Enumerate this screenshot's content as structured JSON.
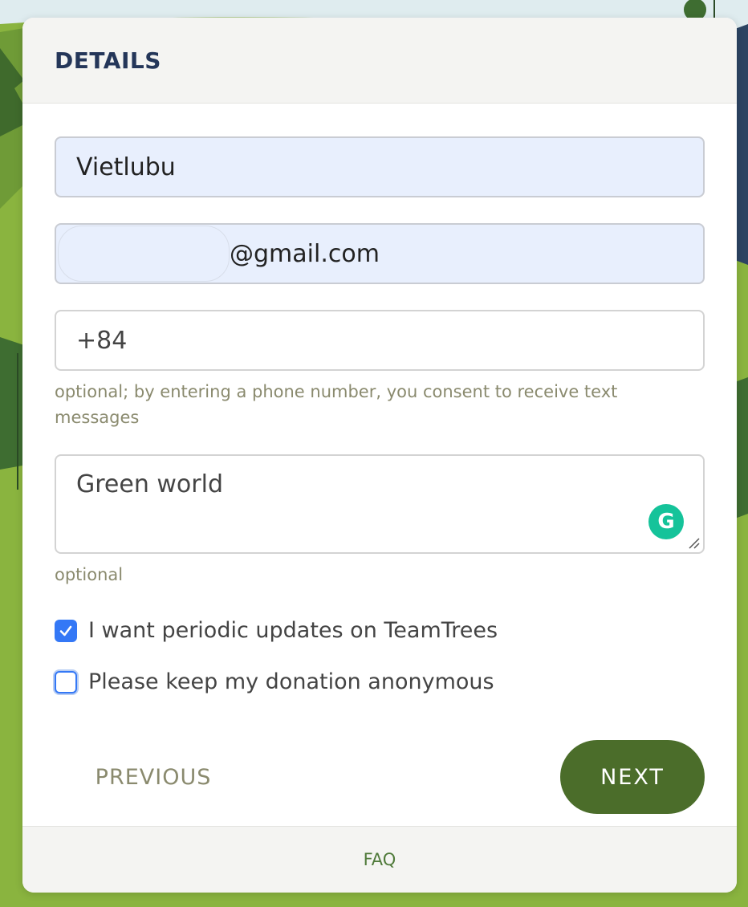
{
  "header": {
    "title": "DETAILS"
  },
  "form": {
    "name_value": "Vietlubu",
    "email_value": "@gmail.com",
    "phone_value": "+84",
    "phone_help": "optional; by entering a phone number, you consent to receive text messages",
    "message_value": "Green world",
    "message_help": "optional",
    "grammarly_icon": "G"
  },
  "checkboxes": [
    {
      "label": "I want periodic updates on TeamTrees",
      "checked": true
    },
    {
      "label": "Please keep my donation anonymous",
      "checked": false
    }
  ],
  "buttons": {
    "previous": "PREVIOUS",
    "next": "NEXT"
  },
  "footer": {
    "faq": "FAQ"
  },
  "colors": {
    "accent": "#4b6d2a",
    "title": "#243659",
    "checkbox": "#3478f6",
    "autofill": "#e8effd",
    "grammarly": "#15c39a"
  },
  "icons": [
    "checkmark-icon",
    "grammarly-icon",
    "resize-handle-icon"
  ]
}
